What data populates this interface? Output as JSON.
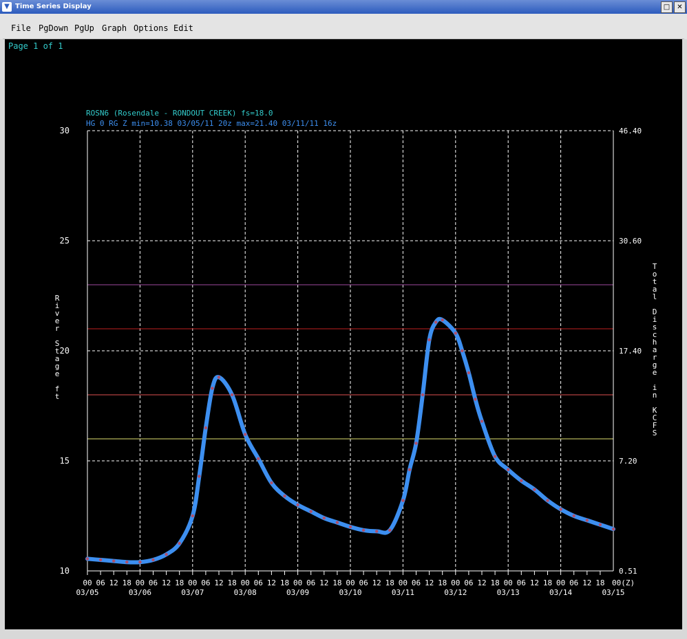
{
  "window": {
    "title": "Time Series Display"
  },
  "menu": {
    "file": "File",
    "pgdown": "PgDown",
    "pgup": "PgUp",
    "graph": "Graph",
    "options": "Options",
    "edit": "Edit"
  },
  "page_label": "Page 1 of 1",
  "colors": {
    "background": "#000000",
    "series": "#3d8ff0",
    "series_points": "#b0506a",
    "grid": "#ffffff",
    "cyan_text": "#33cccc",
    "header2": "#3d8ff0",
    "thresholds": [
      "#a04aa0",
      "#c02020",
      "#e05050",
      "#e0e070"
    ]
  },
  "chart_data": {
    "type": "line",
    "title": "ROSN6 (Rosendale - RONDOUT CREEK) fs=18.0",
    "subtitle": "HG 0 RG Z min=10.38 03/05/11 20z max=21.40 03/11/11 16z",
    "ylabel": "River Stage ft",
    "y2label": "Total Discharge in KCFS",
    "ylim": [
      10,
      30
    ],
    "yticks": [
      "10",
      "15",
      "20",
      "25",
      "30"
    ],
    "y2ticks": [
      "0.51",
      "7.20",
      "17.40",
      "30.60",
      "46.40"
    ],
    "xlim": [
      "03/05 00z",
      "03/15 00z"
    ],
    "x_hour_labels": [
      "00",
      "06",
      "12",
      "18"
    ],
    "x_final_label": "00(Z)",
    "x_date_labels": [
      "03/05",
      "03/06",
      "03/07",
      "03/08",
      "03/09",
      "03/10",
      "03/11",
      "03/12",
      "03/13",
      "03/14",
      "03/15"
    ],
    "thresholds": [
      23.0,
      21.0,
      18.0,
      16.0
    ],
    "series": [
      {
        "x": [
          "03/05 00z",
          "03/05 06z",
          "03/05 12z",
          "03/05 18z",
          "03/06 00z",
          "03/06 06z",
          "03/06 12z",
          "03/06 18z",
          "03/07 00z",
          "03/07 03z",
          "03/07 06z",
          "03/07 09z",
          "03/07 12z",
          "03/07 18z",
          "03/08 00z",
          "03/08 06z",
          "03/08 12z",
          "03/08 18z",
          "03/09 00z",
          "03/09 06z",
          "03/09 12z",
          "03/09 18z",
          "03/10 00z",
          "03/10 06z",
          "03/10 12z",
          "03/10 18z",
          "03/11 00z",
          "03/11 03z",
          "03/11 06z",
          "03/11 09z",
          "03/11 12z",
          "03/11 15z",
          "03/11 18z",
          "03/12 00z",
          "03/12 03z",
          "03/12 06z",
          "03/12 09z",
          "03/12 12z",
          "03/12 18z",
          "03/13 00z",
          "03/13 06z",
          "03/13 12z",
          "03/13 18z",
          "03/14 00z",
          "03/14 06z",
          "03/14 12z",
          "03/14 18z",
          "03/15 00z"
        ],
        "y": [
          10.55,
          10.5,
          10.45,
          10.4,
          10.4,
          10.5,
          10.75,
          11.25,
          12.5,
          14.3,
          16.5,
          18.3,
          18.8,
          18.0,
          16.2,
          15.1,
          14.0,
          13.4,
          13.0,
          12.7,
          12.4,
          12.2,
          12.0,
          11.85,
          11.8,
          11.85,
          13.2,
          14.6,
          15.8,
          18.0,
          20.5,
          21.3,
          21.4,
          20.8,
          20.0,
          19.0,
          17.8,
          16.8,
          15.2,
          14.6,
          14.1,
          13.7,
          13.2,
          12.8,
          12.5,
          12.3,
          12.1,
          11.9
        ]
      }
    ]
  }
}
